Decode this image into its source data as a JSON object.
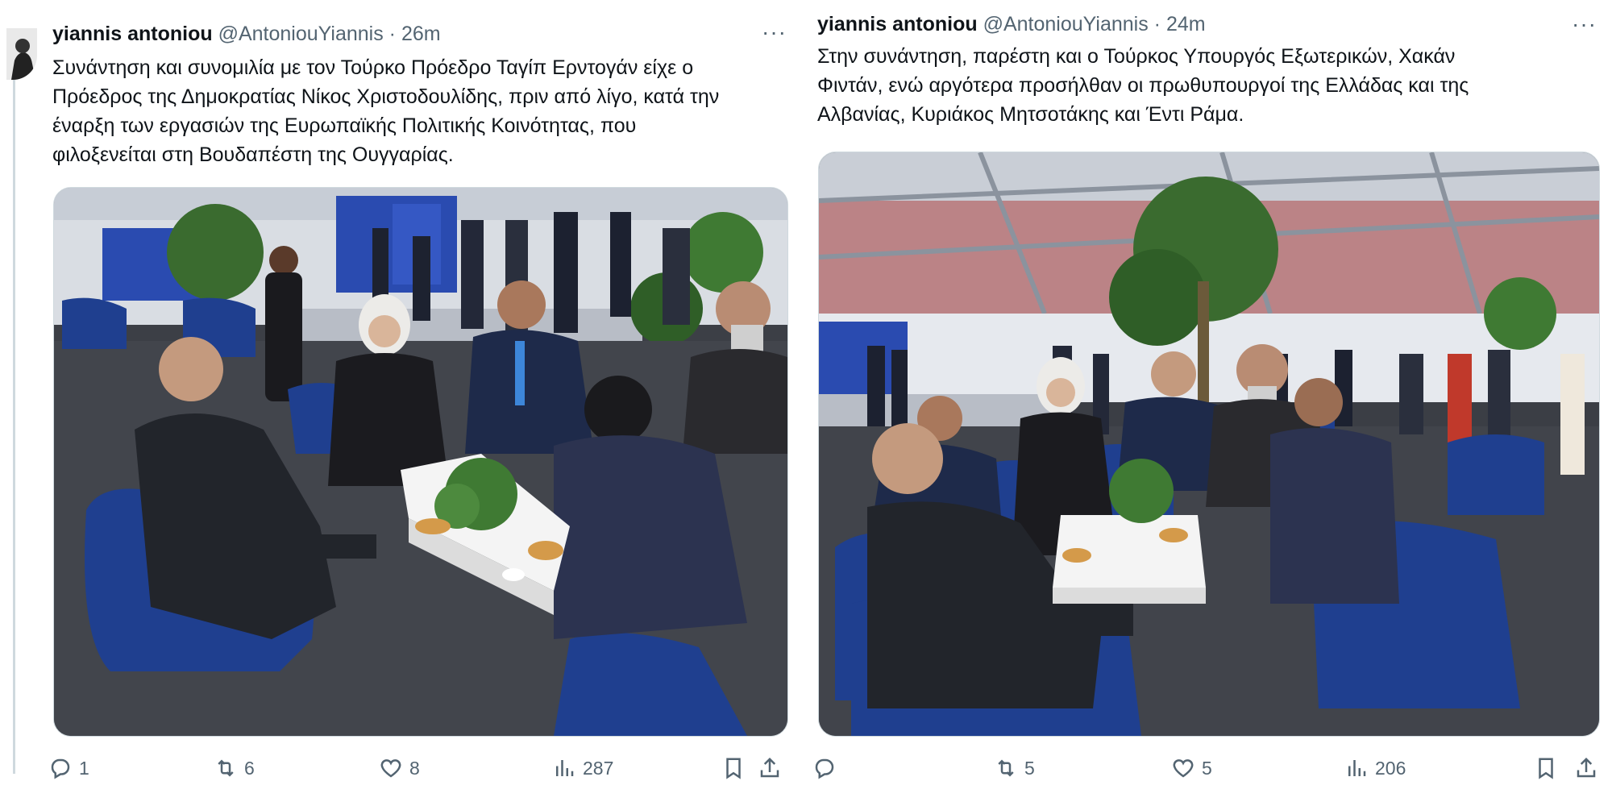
{
  "left_tweet": {
    "author_name": "yiannis antoniou",
    "handle": "@AntoniouYiannis",
    "separator": "·",
    "time": "26m",
    "more": "···",
    "text_lines": [
      "Συνάντηση και συνομιλία με τον Τούρκο Πρόεδρο Ταγίπ Ερντογάν είχε ο",
      "Πρόεδρος της Δημοκρατίας Νίκος Χριστοδουλίδης, πριν από λίγο, κατά την",
      "έναρξη των εργασιών της Ευρωπαϊκής Πολιτικής Κοινότητας, που",
      "φιλοξενείται στη Βουδαπέστη της Ουγγαρίας."
    ],
    "actions": {
      "reply_count": "1",
      "retweet_count": "6",
      "like_count": "8",
      "views_count": "287"
    }
  },
  "right_tweet": {
    "author_name": "yiannis antoniou",
    "handle": "@AntoniouYiannis",
    "separator": "·",
    "time": "24m",
    "more": "···",
    "text_lines": [
      "Στην συνάντηση, παρέστη και ο Τούρκος Υπουργός Εξωτερικών, Χακάν",
      "Φιντάν, ενώ αργότερα προσήλθαν οι πρωθυπουργοί της Ελλάδας και της",
      "Αλβανίας, Κυριάκος Μητσοτάκης και Έντι Ράμα."
    ],
    "actions": {
      "reply_count": "",
      "retweet_count": "5",
      "like_count": "5",
      "views_count": "206"
    }
  },
  "colors": {
    "text": "#0f1419",
    "muted": "#536471",
    "border": "#cfd9de",
    "chair_blue": "#1f3f8f",
    "carpet": "#3a3d44"
  },
  "icons": [
    "reply-icon",
    "retweet-icon",
    "like-icon",
    "views-icon",
    "bookmark-icon",
    "share-icon",
    "more-icon",
    "avatar"
  ]
}
